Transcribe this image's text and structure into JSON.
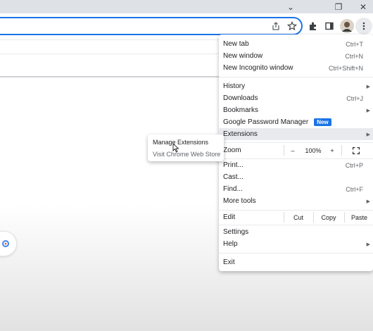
{
  "window": {
    "minimize_glyph": "⌄",
    "restore_glyph": "❐",
    "close_glyph": "✕"
  },
  "toolbar": {
    "icons": [
      "share-icon",
      "star-icon",
      "extensions-icon",
      "side-panel-icon",
      "profile-avatar",
      "more-menu-icon"
    ]
  },
  "menu": {
    "new_tab": {
      "label": "New tab",
      "shortcut": "Ctrl+T"
    },
    "new_window": {
      "label": "New window",
      "shortcut": "Ctrl+N"
    },
    "new_incognito": {
      "label": "New Incognito window",
      "shortcut": "Ctrl+Shift+N"
    },
    "history": {
      "label": "History"
    },
    "downloads": {
      "label": "Downloads",
      "shortcut": "Ctrl+J"
    },
    "bookmarks": {
      "label": "Bookmarks"
    },
    "password_manager": {
      "label": "Google Password Manager",
      "badge": "New"
    },
    "extensions": {
      "label": "Extensions"
    },
    "zoom": {
      "label": "Zoom",
      "minus": "–",
      "value": "100%",
      "plus": "+"
    },
    "print": {
      "label": "Print...",
      "shortcut": "Ctrl+P"
    },
    "cast": {
      "label": "Cast..."
    },
    "find": {
      "label": "Find...",
      "shortcut": "Ctrl+F"
    },
    "more_tools": {
      "label": "More tools"
    },
    "edit": {
      "label": "Edit",
      "cut": "Cut",
      "copy": "Copy",
      "paste": "Paste"
    },
    "settings": {
      "label": "Settings"
    },
    "help": {
      "label": "Help"
    },
    "exit": {
      "label": "Exit"
    }
  },
  "submenu": {
    "manage_extensions": "Manage Extensions",
    "visit_store": "Visit Chrome Web Store"
  },
  "colors": {
    "accent": "#1a73e8",
    "highlight": "#e8eaed"
  }
}
